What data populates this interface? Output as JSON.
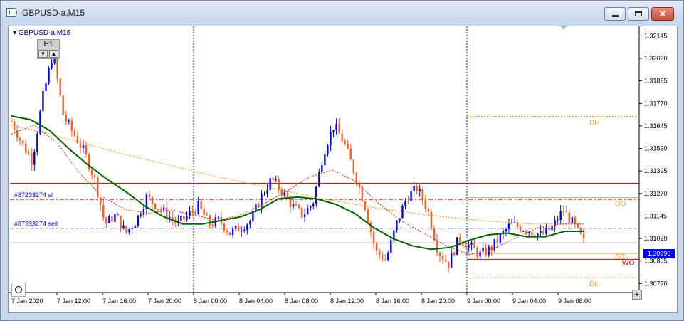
{
  "window": {
    "title": "GBPUSD-a,M15",
    "minimize_icon": "minimize-icon",
    "maximize_icon": "maximize-icon",
    "close_icon": "close-icon"
  },
  "chart": {
    "symbol_label": "GBPUSD-a,M15",
    "timeframe_widget": {
      "label": "H1",
      "down": "▼",
      "up": "▲"
    },
    "current_price": "1.30996",
    "price_ticks": [
      "1.32145",
      "1.32020",
      "1.31895",
      "1.31770",
      "1.31645",
      "1.31520",
      "1.31395",
      "1.31270",
      "1.31145",
      "1.31020",
      "1.30895",
      "1.30770"
    ],
    "time_ticks": [
      "7 Jan 2020",
      "7 Jan 12:00",
      "7 Jan 16:00",
      "7 Jan 20:00",
      "8 Jan 00:00",
      "8 Jan 04:00",
      "8 Jan 08:00",
      "8 Jan 12:00",
      "8 Jan 16:00",
      "8 Jan 20:00",
      "9 Jan 00:00",
      "9 Jan 04:00",
      "9 Jan 08:00"
    ],
    "order_labels": {
      "stop_loss": "#87233274 sl",
      "sell": "#87233274 sell"
    },
    "level_labels": {
      "dh": "DH",
      "do": "DO",
      "dc": "DC",
      "wo": "WO",
      "dl": "DL"
    },
    "colors": {
      "bull": "#0000ff",
      "bear": "#ff5a1f",
      "ma_slow": "#006400",
      "ma_fast": "#cc2200",
      "ma_trend": "#ff8c00",
      "levels": "#f0a030",
      "order": "#0000cc",
      "red_line": "#cc0000"
    },
    "icons": {
      "circle": "circle-tool-icon",
      "plus": "plus-icon"
    }
  },
  "chart_data": {
    "type": "candlestick",
    "symbol": "GBPUSD-a",
    "timeframe": "M15",
    "ylim": [
      1.3072,
      1.3219
    ],
    "ytick_step": 0.00125,
    "x_ticks": [
      "7 Jan 2020",
      "7 Jan 12:00",
      "7 Jan 16:00",
      "7 Jan 20:00",
      "8 Jan 00:00",
      "8 Jan 04:00",
      "8 Jan 08:00",
      "8 Jan 12:00",
      "8 Jan 16:00",
      "8 Jan 20:00",
      "9 Jan 00:00",
      "9 Jan 04:00",
      "9 Jan 08:00"
    ],
    "close_path": [
      1.3167,
      1.3155,
      1.3145,
      1.318,
      1.3205,
      1.317,
      1.316,
      1.315,
      1.3135,
      1.311,
      1.3115,
      1.3105,
      1.3112,
      1.3125,
      1.312,
      1.3115,
      1.311,
      1.3115,
      1.312,
      1.311,
      1.3112,
      1.3105,
      1.3108,
      1.3112,
      1.3125,
      1.3135,
      1.3128,
      1.312,
      1.3115,
      1.3122,
      1.315,
      1.3165,
      1.3155,
      1.3138,
      1.312,
      1.3095,
      1.309,
      1.311,
      1.3125,
      1.313,
      1.3118,
      1.3095,
      1.3088,
      1.3102,
      1.3098,
      1.3093,
      1.3096,
      1.3103,
      1.311,
      1.3108,
      1.3106,
      1.3104,
      1.3108,
      1.3118,
      1.311,
      1.31
    ],
    "moving_averages": {
      "slow_green": [
        1.317,
        1.3168,
        1.3162,
        1.3152,
        1.3143,
        1.3135,
        1.3128,
        1.312,
        1.3114,
        1.311,
        1.311,
        1.3112,
        1.3114,
        1.3118,
        1.3124,
        1.3125,
        1.3124,
        1.3121,
        1.3116,
        1.3108,
        1.3102,
        1.3098,
        1.3096,
        1.3097,
        1.3101,
        1.3104,
        1.3105,
        1.3103,
        1.3103,
        1.3106,
        1.3106
      ],
      "fast_red": [
        1.316,
        1.3165,
        1.3155,
        1.3138,
        1.3125,
        1.3118,
        1.3116,
        1.3118,
        1.3115,
        1.3112,
        1.3115,
        1.3121,
        1.3128,
        1.3136,
        1.314,
        1.3134,
        1.3122,
        1.3112,
        1.3105,
        1.3098,
        1.3093,
        1.3096,
        1.3102,
        1.3108,
        1.311,
        1.311
      ],
      "trend_orange": [
        1.3165,
        1.3158,
        1.315,
        1.3143,
        1.3136,
        1.313,
        1.3124,
        1.3119,
        1.3115,
        1.3112,
        1.311,
        1.311
      ]
    },
    "levels": {
      "red_resistance": 1.31327,
      "order_stop_loss": 1.31237,
      "order_sell": 1.31077,
      "current_bid": 1.30996,
      "DH": 1.31698,
      "DO": 1.31247,
      "DC": 1.30937,
      "WO": 1.30904,
      "DL": 1.30802
    },
    "day_separators": [
      "8 Jan 00:00",
      "9 Jan 00:00"
    ]
  }
}
